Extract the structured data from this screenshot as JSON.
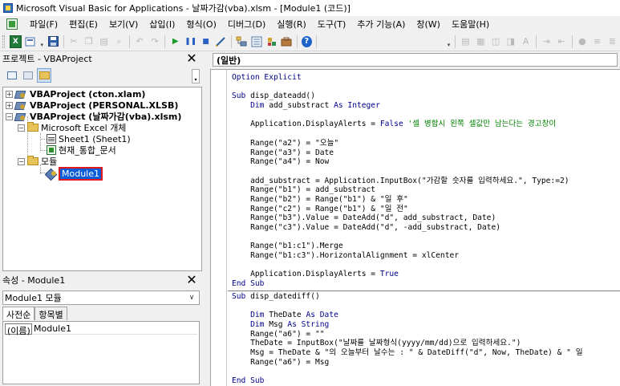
{
  "window": {
    "title": "Microsoft Visual Basic for Applications - 날짜가감(vba).xlsm - [Module1 (코드)]"
  },
  "menu": {
    "items": [
      "파일(F)",
      "편집(E)",
      "보기(V)",
      "삽입(I)",
      "형식(O)",
      "디버그(D)",
      "실행(R)",
      "도구(T)",
      "추가 기능(A)",
      "창(W)",
      "도움말(H)"
    ]
  },
  "toolbar": {
    "icons": [
      "excel-view-icon",
      "insert-dropdown-icon",
      "save-icon",
      "cut-icon",
      "copy-icon",
      "paste-icon",
      "find-icon",
      "undo-icon",
      "redo-icon",
      "run-icon",
      "break-icon",
      "reset-icon",
      "design-mode-icon",
      "project-explorer-icon",
      "properties-window-icon",
      "object-browser-icon",
      "toolbox-icon",
      "help-icon"
    ],
    "help_glyph": "?"
  },
  "project": {
    "title": "프로젝트 - VBAProject",
    "close": "✕",
    "tree": {
      "projects": [
        {
          "label": "VBAProject (cton.xlam)",
          "expander": "+"
        },
        {
          "label": "VBAProject (PERSONAL.XLSB)",
          "expander": "+"
        },
        {
          "label": "VBAProject (날짜가감(vba).xlsm)",
          "expander": "−"
        }
      ],
      "excel_objects_folder": "Microsoft Excel 개체",
      "sheet1": "Sheet1 (Sheet1)",
      "workbook": "현재_통합_문서",
      "modules_folder": "모듈",
      "module1": "Module1"
    }
  },
  "properties": {
    "title": "속성 - Module1",
    "close": "✕",
    "combo_value": "Module1 모듈",
    "tabs": [
      "사전순",
      "항목별"
    ],
    "rows": [
      {
        "key": "(이름)",
        "value": "Module1"
      }
    ]
  },
  "code": {
    "object_combo": "(일반)",
    "section1": [
      [
        {
          "t": "Option Explicit",
          "c": "kw"
        }
      ],
      [],
      [
        {
          "t": "Sub ",
          "c": "kw"
        },
        {
          "t": "disp_dateadd()"
        }
      ],
      [
        {
          "t": "    Dim ",
          "c": "kw"
        },
        {
          "t": "add_substract "
        },
        {
          "t": "As Integer",
          "c": "kw"
        }
      ],
      [],
      [
        {
          "t": "    Application.DisplayAlerts = "
        },
        {
          "t": "False",
          "c": "kw"
        },
        {
          "t": " '셀 병합시 왼쪽 셀값만 남는다는 경고창이",
          "c": "cm"
        }
      ],
      [],
      [
        {
          "t": "    Range(\"a2\") = \"오늘\""
        }
      ],
      [
        {
          "t": "    Range(\"a3\") = Date"
        }
      ],
      [
        {
          "t": "    Range(\"a4\") = Now"
        }
      ],
      [],
      [
        {
          "t": "    add_substract = Application.InputBox(\"가감할 숫자를 입력하세요.\", Type:=2)"
        }
      ],
      [
        {
          "t": "    Range(\"b1\") = add_substract"
        }
      ],
      [
        {
          "t": "    Range(\"b2\") = Range(\"b1\") & \"일 후\""
        }
      ],
      [
        {
          "t": "    Range(\"c2\") = Range(\"b1\") & \"일 전\""
        }
      ],
      [
        {
          "t": "    Range(\"b3\").Value = DateAdd(\"d\", add_substract, Date)"
        }
      ],
      [
        {
          "t": "    Range(\"c3\").Value = DateAdd(\"d\", -add_substract, Date)"
        }
      ],
      [],
      [
        {
          "t": "    Range(\"b1:c1\").Merge"
        }
      ],
      [
        {
          "t": "    Range(\"b1:c3\").HorizontalAlignment = xlCenter"
        }
      ],
      [],
      [
        {
          "t": "    Application.DisplayAlerts = "
        },
        {
          "t": "True",
          "c": "kw"
        }
      ],
      [
        {
          "t": "End Sub",
          "c": "kw"
        }
      ]
    ],
    "section2": [
      [
        {
          "t": "Sub ",
          "c": "kw"
        },
        {
          "t": "disp_datediff()"
        }
      ],
      [],
      [
        {
          "t": "    Dim ",
          "c": "kw"
        },
        {
          "t": "TheDate "
        },
        {
          "t": "As Date",
          "c": "kw"
        }
      ],
      [
        {
          "t": "    Dim ",
          "c": "kw"
        },
        {
          "t": "Msg "
        },
        {
          "t": "As String",
          "c": "kw"
        }
      ],
      [
        {
          "t": "    Range(\"a6\") = \"\""
        }
      ],
      [
        {
          "t": "    TheDate = InputBox(\"날짜를 날짜형식(yyyy/mm/dd)으로 입력하세요.\")"
        }
      ],
      [
        {
          "t": "    Msg = TheDate & \"의 오늘부터 날수는 : \" & DateDiff(\"d\", Now, TheDate) & \" 일"
        }
      ],
      [
        {
          "t": "    Range(\"a6\") = Msg"
        }
      ],
      [],
      [
        {
          "t": "End Sub",
          "c": "kw"
        }
      ]
    ]
  }
}
